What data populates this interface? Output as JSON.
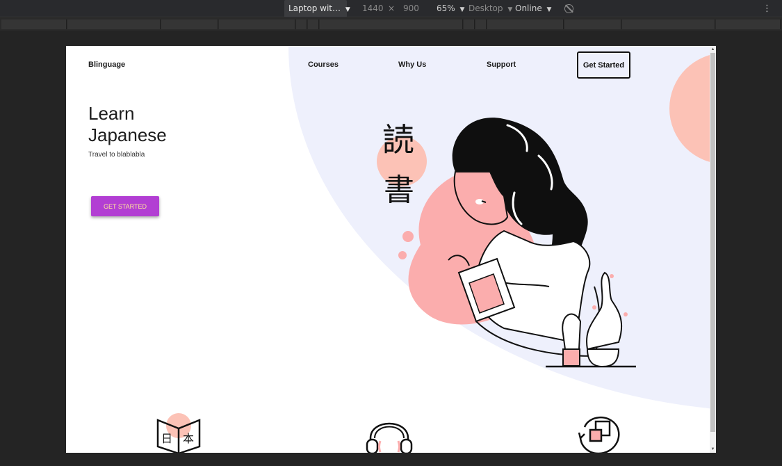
{
  "devtools": {
    "device": "Laptop wit…",
    "width": "1440",
    "times": "×",
    "height": "900",
    "zoom": "65%",
    "mode": "Desktop",
    "network": "Online",
    "more_menu": "⋮"
  },
  "site": {
    "brand": "Blinguage",
    "nav": [
      "Courses",
      "Why Us",
      "Support"
    ],
    "nav_cta": "Get Started",
    "hero_title_line1": "Learn",
    "hero_title_line2": "Japanese",
    "hero_subtitle": "Travel to blablabla",
    "hero_button": "GET STARTED",
    "kanji_1": "読",
    "kanji_2": "書",
    "book_glyph_left": "日",
    "book_glyph_right": "本"
  },
  "colors": {
    "accent_purple": "#b23ed3",
    "button_text": "#ffe59c",
    "hero_background": "#eef0fc",
    "pink": "#fcc2b6"
  },
  "icons": [
    "dropdown-caret-icon",
    "rotate-icon",
    "kebab-menu-icon",
    "book-icon",
    "headphones-icon",
    "refresh-squares-icon"
  ]
}
